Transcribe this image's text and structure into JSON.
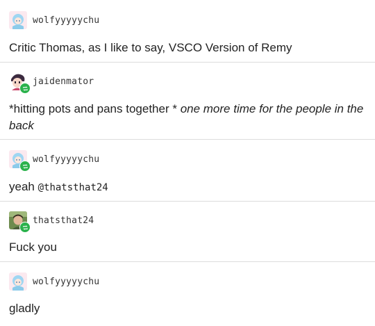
{
  "thread": [
    {
      "username": "wolfyyyyychu",
      "avatar_icon": "anime-girl-avatar-icon",
      "reblog_badge": false,
      "text": "Critic Thomas,  as I like to say, VSCO Version of Remy"
    },
    {
      "username": "jaidenmator",
      "avatar_icon": "cartoon-character-avatar-icon",
      "reblog_badge": true,
      "text_plain": "*hitting pots and pans together * ",
      "text_italic": "one more time for the people in the back"
    },
    {
      "username": "wolfyyyyychu",
      "avatar_icon": "anime-girl-avatar-icon",
      "reblog_badge": true,
      "text_plain": "yeah ",
      "mention": "@thatsthat24"
    },
    {
      "username": "thatsthat24",
      "avatar_icon": "photo-avatar-icon",
      "reblog_badge": true,
      "text": "Fuck you"
    },
    {
      "username": "wolfyyyyychu",
      "avatar_icon": "anime-girl-avatar-icon",
      "reblog_badge": false,
      "text": "gladly"
    }
  ],
  "colors": {
    "reblog_badge": "#2bb24c",
    "divider": "#dcdcdc",
    "text": "#222222"
  }
}
